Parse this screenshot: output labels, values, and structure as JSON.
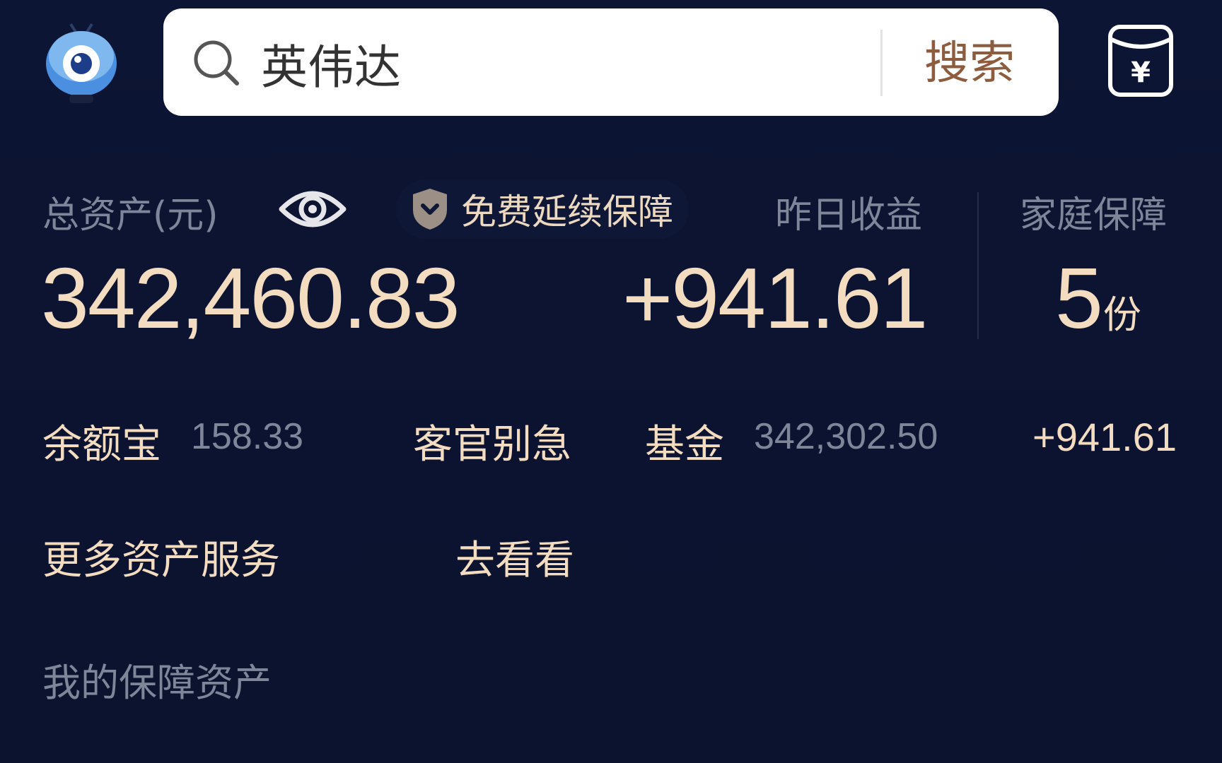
{
  "search": {
    "value": "英伟达",
    "button_label": "搜索"
  },
  "assets": {
    "total_label": "总资产(元)",
    "total_value": "342,460.83",
    "protect_badge": "免费延续保障",
    "yesterday_label": "昨日收益",
    "yesterday_value": "+941.61",
    "family_label": "家庭保障",
    "family_count": "5",
    "family_unit": "份"
  },
  "breakdown": {
    "yeb_label": "余额宝",
    "yeb_value": "158.33",
    "slogan": "客官别急",
    "fund_label": "基金",
    "fund_value": "342,302.50",
    "fund_gain": "+941.61"
  },
  "more": {
    "label": "更多资产服务",
    "link": "去看看"
  },
  "section": {
    "title": "我的保障资产"
  },
  "colors": {
    "background": "#0c1432",
    "gold_text": "#f3dcc0",
    "muted_text": "#7f8699",
    "search_button": "#8d5c3e"
  },
  "icons": {
    "avatar": "mascot-avatar-icon",
    "search": "search-icon",
    "red_envelope": "red-envelope-yuan-icon",
    "eye": "eye-icon",
    "shield": "shield-icon"
  }
}
